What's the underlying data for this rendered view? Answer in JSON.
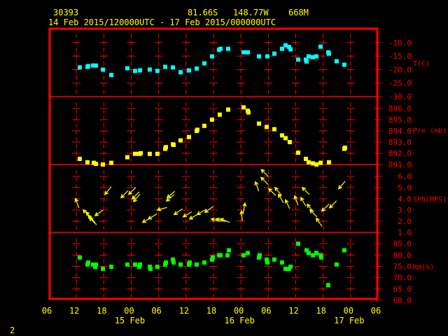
{
  "header": {
    "station": "30393",
    "latitude": "81.66S",
    "longitude": "148.77W",
    "elevation": "668M",
    "period": "14 Feb 2015/120000UTC - 17 Feb 2015/000000UTC"
  },
  "footer": {
    "page": "2"
  },
  "colors": {
    "background": "#000000",
    "frame": "#ff0000",
    "text": "#ffff00",
    "temperature": "#00ffff",
    "pressure": "#ffff00",
    "wind": "#ffff00",
    "humidity": "#00ff00"
  },
  "chart_data": {
    "type": "scatter",
    "xlim": [
      "2015-02-14 06:00",
      "2015-02-17 06:00"
    ],
    "x_tick_labels": [
      "06",
      "12",
      "18",
      "00",
      "06",
      "12",
      "18",
      "00",
      "06",
      "12",
      "18",
      "00",
      "06"
    ],
    "x_date_labels": [
      {
        "label": "15 Feb",
        "at": "2015-02-15 00:00"
      },
      {
        "label": "16 Feb",
        "at": "2015-02-16 00:00"
      },
      {
        "label": "17 Feb",
        "at": "2015-02-17 00:00"
      }
    ],
    "grid": true,
    "panels": [
      {
        "key": "temperature",
        "ylabel": "T(C)",
        "ylim": [
          -30,
          -4.6
        ],
        "ticks": [
          "-10.0",
          "-15.0",
          "-20.0",
          "-25.0",
          "-30.0"
        ],
        "tick_values": [
          -10,
          -15,
          -20,
          -25,
          -30
        ],
        "points": [
          [
            "2015-02-14 12:44",
            -19.2
          ],
          [
            "2015-02-14 14:25",
            -19.0
          ],
          [
            "2015-02-14 14:35",
            -18.7
          ],
          [
            "2015-02-14 15:39",
            -18.5
          ],
          [
            "2015-02-14 16:16",
            -18.5
          ],
          [
            "2015-02-14 17:48",
            -20.0
          ],
          [
            "2015-02-14 19:38",
            -22.0
          ],
          [
            "2015-02-14 23:09",
            -19.5
          ],
          [
            "2015-02-15 00:50",
            -20.5
          ],
          [
            "2015-02-15 01:55",
            -20.3
          ],
          [
            "2015-02-15 04:03",
            -20.0
          ],
          [
            "2015-02-15 05:44",
            -20.5
          ],
          [
            "2015-02-15 07:26",
            -19.0
          ],
          [
            "2015-02-15 09:07",
            -19.2
          ],
          [
            "2015-02-15 10:48",
            -21.0
          ],
          [
            "2015-02-15 12:38",
            -20.3
          ],
          [
            "2015-02-15 14:19",
            -19.6
          ],
          [
            "2015-02-15 16:00",
            -17.7
          ],
          [
            "2015-02-15 17:41",
            -15.1
          ],
          [
            "2015-02-15 19:13",
            -12.7
          ],
          [
            "2015-02-15 19:32",
            -12.3
          ],
          [
            "2015-02-15 21:13",
            -12.3
          ],
          [
            "2015-02-16 00:35",
            -13.6
          ],
          [
            "2015-02-16 01:30",
            -13.6
          ],
          [
            "2015-02-16 03:57",
            -15.1
          ],
          [
            "2015-02-16 05:47",
            -15.1
          ],
          [
            "2015-02-16 07:19",
            -14.1
          ],
          [
            "2015-02-16 09:00",
            -12.3
          ],
          [
            "2015-02-16 09:46",
            -11.0
          ],
          [
            "2015-02-16 10:32",
            -11.6
          ],
          [
            "2015-02-16 10:51",
            -12.5
          ],
          [
            "2015-02-16 12:32",
            -16.3
          ],
          [
            "2015-02-16 14:13",
            -16.3
          ],
          [
            "2015-02-16 14:22",
            -17.0
          ],
          [
            "2015-02-16 14:49",
            -15.1
          ],
          [
            "2015-02-16 15:45",
            -15.4
          ],
          [
            "2015-02-16 16:31",
            -15.1
          ],
          [
            "2015-02-16 17:26",
            -11.5
          ],
          [
            "2015-02-16 19:07",
            -13.6
          ],
          [
            "2015-02-16 19:16",
            -14.1
          ],
          [
            "2015-02-16 20:57",
            -16.9
          ],
          [
            "2015-02-16 22:38",
            -18.2
          ]
        ]
      },
      {
        "key": "pressure",
        "ylabel": "Pre (mb)",
        "ylim": [
          891.0,
          897.06
        ],
        "ticks": [
          "896.0",
          "895.0",
          "894.0",
          "893.0",
          "892.0",
          "891.0"
        ],
        "tick_values": [
          896,
          895,
          894,
          893,
          892,
          891
        ],
        "points": [
          [
            "2015-02-14 12:44",
            891.5
          ],
          [
            "2015-02-14 14:25",
            891.2
          ],
          [
            "2015-02-14 15:48",
            891.15
          ],
          [
            "2015-02-14 16:16",
            891.06
          ],
          [
            "2015-02-14 17:48",
            891.0
          ],
          [
            "2015-02-14 19:38",
            891.15
          ],
          [
            "2015-02-14 23:09",
            891.65
          ],
          [
            "2015-02-15 00:50",
            891.95
          ],
          [
            "2015-02-15 01:45",
            891.95
          ],
          [
            "2015-02-15 02:04",
            892.0
          ],
          [
            "2015-02-15 04:03",
            891.95
          ],
          [
            "2015-02-15 05:44",
            891.95
          ],
          [
            "2015-02-15 07:26",
            892.4
          ],
          [
            "2015-02-15 07:35",
            892.55
          ],
          [
            "2015-02-15 09:07",
            892.8
          ],
          [
            "2015-02-15 09:16",
            892.75
          ],
          [
            "2015-02-15 10:48",
            893.15
          ],
          [
            "2015-02-15 12:38",
            893.45
          ],
          [
            "2015-02-15 14:19",
            894.0
          ],
          [
            "2015-02-15 14:28",
            894.1
          ],
          [
            "2015-02-15 16:00",
            894.45
          ],
          [
            "2015-02-15 17:41",
            895.0
          ],
          [
            "2015-02-15 19:22",
            895.45
          ],
          [
            "2015-02-15 21:13",
            895.9
          ],
          [
            "2015-02-16 00:35",
            896.1
          ],
          [
            "2015-02-16 01:30",
            895.8
          ],
          [
            "2015-02-16 01:39",
            895.65
          ],
          [
            "2015-02-16 03:57",
            894.65
          ],
          [
            "2015-02-16 05:38",
            894.35
          ],
          [
            "2015-02-16 07:19",
            894.15
          ],
          [
            "2015-02-16 09:00",
            893.6
          ],
          [
            "2015-02-16 09:46",
            893.35
          ],
          [
            "2015-02-16 10:41",
            893.0
          ],
          [
            "2015-02-16 12:32",
            892.05
          ],
          [
            "2015-02-16 14:13",
            891.5
          ],
          [
            "2015-02-16 14:49",
            891.2
          ],
          [
            "2015-02-16 15:45",
            891.1
          ],
          [
            "2015-02-16 16:31",
            891.0
          ],
          [
            "2015-02-16 17:26",
            891.15
          ],
          [
            "2015-02-16 19:16",
            891.2
          ],
          [
            "2015-02-16 22:38",
            892.4
          ],
          [
            "2015-02-16 22:47",
            892.5
          ]
        ]
      },
      {
        "key": "wind",
        "ylabel": "SPD(MPS)",
        "ylim": [
          1.0,
          7.06
        ],
        "ticks": [
          "6.0",
          "5.0",
          "4.0",
          "3.0",
          "2.0",
          "1.0"
        ],
        "tick_values": [
          6,
          5,
          4,
          3,
          2,
          1
        ],
        "points": [
          [
            "2015-02-14 11:49",
            4.0,
            340
          ],
          [
            "2015-02-14 13:30",
            3.0,
            315
          ],
          [
            "2015-02-14 14:07",
            2.8,
            315
          ],
          [
            "2015-02-14 14:35",
            2.5,
            315
          ],
          [
            "2015-02-14 14:53",
            2.3,
            315
          ],
          [
            "2015-02-14 16:07",
            2.5,
            235
          ],
          [
            "2015-02-14 18:15",
            4.4,
            220
          ],
          [
            "2015-02-14 21:47",
            4.1,
            225
          ],
          [
            "2015-02-14 23:28",
            4.4,
            225
          ],
          [
            "2015-02-15 00:14",
            4.0,
            225
          ],
          [
            "2015-02-15 00:32",
            3.75,
            220
          ],
          [
            "2015-02-15 02:31",
            1.9,
            240
          ],
          [
            "2015-02-15 03:45",
            2.2,
            240
          ],
          [
            "2015-02-15 05:44",
            3.0,
            255
          ],
          [
            "2015-02-15 07:44",
            3.8,
            230
          ],
          [
            "2015-02-15 07:53",
            4.1,
            230
          ],
          [
            "2015-02-15 09:25",
            2.6,
            235
          ],
          [
            "2015-02-15 11:24",
            2.4,
            240
          ],
          [
            "2015-02-15 12:47",
            2.2,
            240
          ],
          [
            "2015-02-15 14:28",
            2.6,
            240
          ],
          [
            "2015-02-15 16:09",
            2.8,
            235
          ],
          [
            "2015-02-15 17:32",
            2.2,
            285
          ],
          [
            "2015-02-15 18:36",
            2.2,
            285
          ],
          [
            "2015-02-15 19:32",
            2.2,
            290
          ],
          [
            "2015-02-16 00:07",
            2.9,
            355
          ],
          [
            "2015-02-16 00:53",
            3.6,
            10
          ],
          [
            "2015-02-16 03:11",
            5.5,
            340
          ],
          [
            "2015-02-16 04:25",
            5.9,
            315
          ],
          [
            "2015-02-16 04:30",
            6.6,
            315
          ],
          [
            "2015-02-16 06:06",
            4.9,
            315
          ],
          [
            "2015-02-16 07:28",
            5.0,
            320
          ],
          [
            "2015-02-16 08:14",
            4.4,
            330
          ],
          [
            "2015-02-16 09:46",
            3.9,
            335
          ],
          [
            "2015-02-16 11:46",
            4.25,
            340
          ],
          [
            "2015-02-16 13:08",
            4.1,
            330
          ],
          [
            "2015-02-16 13:27",
            5.0,
            315
          ],
          [
            "2015-02-16 14:31",
            3.5,
            320
          ],
          [
            "2015-02-16 15:08",
            3.0,
            315
          ],
          [
            "2015-02-16 16:31",
            2.25,
            325
          ],
          [
            "2015-02-16 17:44",
            2.9,
            225
          ],
          [
            "2015-02-16 19:25",
            3.2,
            225
          ],
          [
            "2015-02-16 21:25",
            4.9,
            220
          ]
        ]
      },
      {
        "key": "humidity",
        "ylabel": "RH(%)",
        "ylim": [
          60.0,
          90.0
        ],
        "ticks": [
          "85.0",
          "80.0",
          "75.0",
          "70.0",
          "65.0",
          "60.0"
        ],
        "tick_values": [
          85,
          80,
          75,
          70,
          65,
          60
        ],
        "points": [
          [
            "2015-02-14 12:44",
            78.9
          ],
          [
            "2015-02-14 14:25",
            75.8
          ],
          [
            "2015-02-14 14:35",
            76.7
          ],
          [
            "2015-02-14 15:39",
            75.8
          ],
          [
            "2015-02-14 16:07",
            74.7
          ],
          [
            "2015-02-14 16:16",
            75.8
          ],
          [
            "2015-02-14 17:48",
            73.9
          ],
          [
            "2015-02-14 19:38",
            74.8
          ],
          [
            "2015-02-14 23:09",
            75.8
          ],
          [
            "2015-02-15 00:50",
            75.8
          ],
          [
            "2015-02-15 01:45",
            74.8
          ],
          [
            "2015-02-15 01:55",
            75.8
          ],
          [
            "2015-02-15 04:03",
            74.8
          ],
          [
            "2015-02-15 04:13",
            73.9
          ],
          [
            "2015-02-15 05:44",
            74.8
          ],
          [
            "2015-02-15 07:26",
            75.8
          ],
          [
            "2015-02-15 07:35",
            76.7
          ],
          [
            "2015-02-15 09:07",
            78.0
          ],
          [
            "2015-02-15 09:16",
            76.7
          ],
          [
            "2015-02-15 10:48",
            75.8
          ],
          [
            "2015-02-15 12:38",
            75.8
          ],
          [
            "2015-02-15 12:47",
            76.7
          ],
          [
            "2015-02-15 14:19",
            75.8
          ],
          [
            "2015-02-15 16:00",
            76.7
          ],
          [
            "2015-02-15 17:41",
            78.0
          ],
          [
            "2015-02-15 17:50",
            78.9
          ],
          [
            "2015-02-15 19:13",
            79.9
          ],
          [
            "2015-02-15 19:32",
            79.9
          ],
          [
            "2015-02-15 21:03",
            79.9
          ],
          [
            "2015-02-15 21:22",
            82.1
          ],
          [
            "2015-02-16 00:35",
            79.9
          ],
          [
            "2015-02-16 01:30",
            80.9
          ],
          [
            "2015-02-16 03:57",
            78.9
          ],
          [
            "2015-02-16 04:06",
            79.9
          ],
          [
            "2015-02-16 05:38",
            78.0
          ],
          [
            "2015-02-16 05:47",
            76.7
          ],
          [
            "2015-02-16 07:19",
            78.0
          ],
          [
            "2015-02-16 09:00",
            76.7
          ],
          [
            "2015-02-16 09:46",
            73.9
          ],
          [
            "2015-02-16 10:32",
            73.9
          ],
          [
            "2015-02-16 10:51",
            74.8
          ],
          [
            "2015-02-16 12:32",
            85.0
          ],
          [
            "2015-02-16 14:22",
            82.1
          ],
          [
            "2015-02-16 14:49",
            80.9
          ],
          [
            "2015-02-16 15:45",
            79.9
          ],
          [
            "2015-02-16 16:31",
            80.9
          ],
          [
            "2015-02-16 17:26",
            79.9
          ],
          [
            "2015-02-16 17:35",
            78.9
          ],
          [
            "2015-02-16 19:07",
            66.7
          ],
          [
            "2015-02-16 20:57",
            75.8
          ],
          [
            "2015-02-16 22:38",
            82.1
          ]
        ]
      }
    ]
  }
}
